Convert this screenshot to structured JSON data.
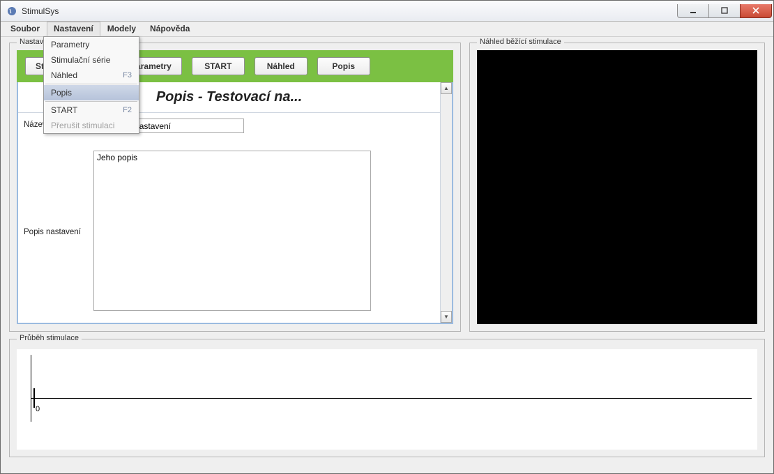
{
  "window": {
    "title": "StimulSys"
  },
  "menubar": {
    "items": [
      "Soubor",
      "Nastavení",
      "Modely",
      "Nápověda"
    ],
    "active_index": 1
  },
  "dropdown": {
    "items": [
      {
        "label": "Parametry",
        "accel": ""
      },
      {
        "label": "Stimulační série",
        "accel": ""
      },
      {
        "label": "Náhled",
        "accel": "F3",
        "sep_after": true
      },
      {
        "label": "Popis",
        "accel": "",
        "selected": true,
        "sep_after": true
      },
      {
        "label": "START",
        "accel": "F2"
      },
      {
        "label": "Přerušit stimulaci",
        "accel": "",
        "disabled": true
      }
    ]
  },
  "settings": {
    "legend": "Nastavení",
    "toolbar": {
      "btn_series": "Stimulační série",
      "btn_params": "Parametry",
      "btn_start": "START",
      "btn_preview": "Náhled",
      "btn_desc": "Popis"
    },
    "doc": {
      "heading": "Popis - Testovací na...",
      "name_label": "Název nastavení",
      "name_value": "Testovací nastavení",
      "desc_label": "Popis nastavení",
      "desc_value": "Jeho popis"
    }
  },
  "preview": {
    "legend": "Náhled běžící stimulace"
  },
  "timeline": {
    "legend": "Průběh stimulace",
    "zero_label": "0"
  }
}
